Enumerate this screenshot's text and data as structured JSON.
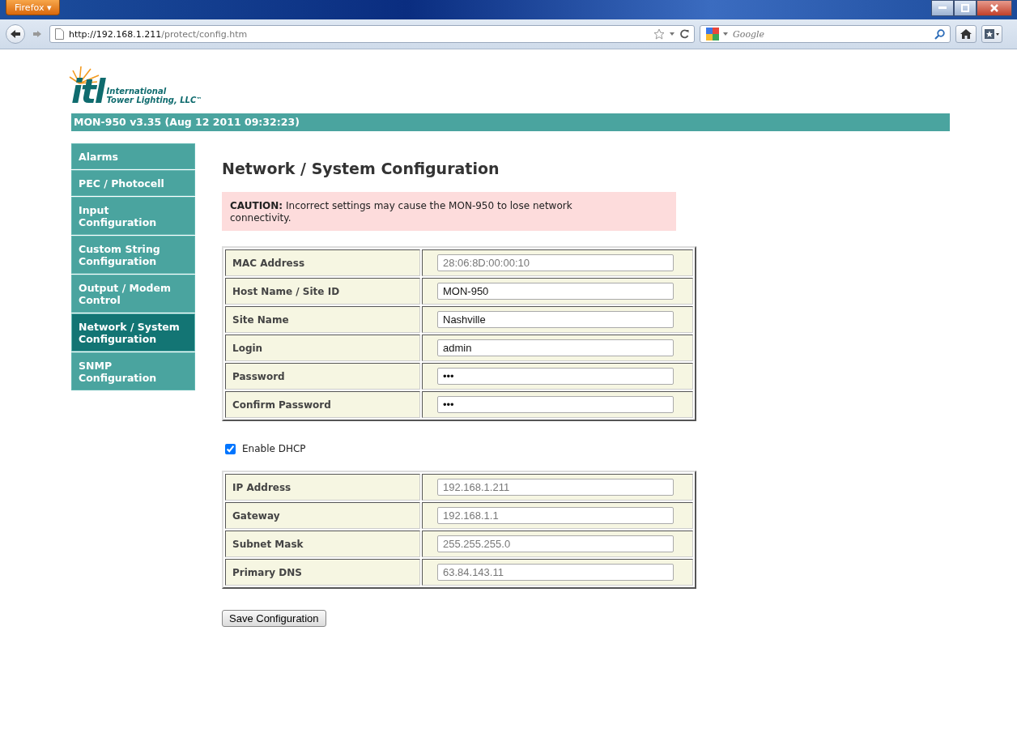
{
  "browser": {
    "menu_button": "Firefox ▾",
    "url_host": "http://192.168.1.211",
    "url_path": "/protect/config.htm",
    "search_placeholder": "Google"
  },
  "logo": {
    "mark": "itl",
    "line_1": "International",
    "line_2": "Tower Lighting, LLC",
    "trademark": "™"
  },
  "header": "MON-950 v3.35 (Aug 12 2011 09:32:23)",
  "sidebar": {
    "items": [
      {
        "label": "Alarms",
        "selected": false
      },
      {
        "label": "PEC / Photocell",
        "selected": false
      },
      {
        "label": "Input Configuration",
        "selected": false
      },
      {
        "label": "Custom String Configuration",
        "selected": false
      },
      {
        "label": "Output / Modem Control",
        "selected": false
      },
      {
        "label": "Network / System Configuration",
        "selected": true
      },
      {
        "label": "SNMP Configuration",
        "selected": false
      }
    ]
  },
  "page_title": "Network / System Configuration",
  "caution": "**CAUTION:** Incorrect settings may cause the MON-950 to lose network connectivity.",
  "system_fields": [
    {
      "label": "MAC Address",
      "value": "28:06:8D:00:00:10",
      "disabled": true
    },
    {
      "label": "Host Name / Site ID",
      "value": "MON-950",
      "disabled": false
    },
    {
      "label": "Site Name",
      "value": "Nashville",
      "disabled": false
    },
    {
      "label": "Login",
      "value": "admin",
      "disabled": false
    },
    {
      "label": "Password",
      "value": "•••",
      "disabled": false
    },
    {
      "label": "Confirm Password",
      "value": "•••",
      "disabled": false
    }
  ],
  "dhcp": {
    "label": "Enable DHCP",
    "checked": true
  },
  "network_fields": [
    {
      "label": "IP Address",
      "value": "192.168.1.211",
      "disabled": true
    },
    {
      "label": "Gateway",
      "value": "192.168.1.1",
      "disabled": true
    },
    {
      "label": "Subnet Mask",
      "value": "255.255.255.0",
      "disabled": true
    },
    {
      "label": "Primary DNS",
      "value": "63.84.143.11",
      "disabled": true
    }
  ],
  "save_button": "Save Configuration"
}
